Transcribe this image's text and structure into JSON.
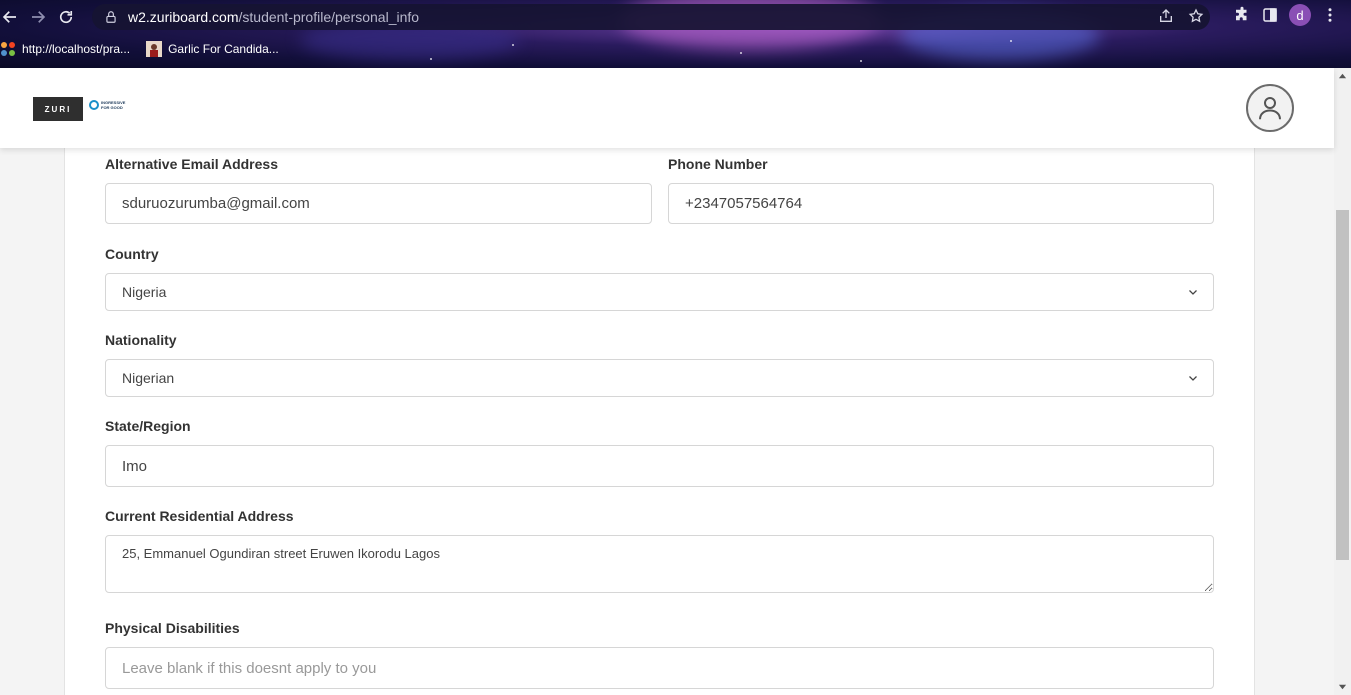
{
  "browser": {
    "url_host": "w2.zuriboard.com",
    "url_path": "/student-profile/personal_info",
    "profile_initial": "d",
    "bookmarks": [
      {
        "label": "http://localhost/pra..."
      },
      {
        "label": "Garlic For Candida..."
      }
    ]
  },
  "header": {
    "logo_text": "ZURI",
    "partner_logo_line1": "INGRESSIVE",
    "partner_logo_line2": "FOR GOOD"
  },
  "form": {
    "alt_email": {
      "label": "Alternative Email Address",
      "value": "sduruozurumba@gmail.com"
    },
    "phone": {
      "label": "Phone Number",
      "value": "+2347057564764"
    },
    "country": {
      "label": "Country",
      "value": "Nigeria"
    },
    "nationality": {
      "label": "Nationality",
      "value": "Nigerian"
    },
    "state": {
      "label": "State/Region",
      "value": "Imo"
    },
    "address": {
      "label": "Current Residential Address",
      "value": "25, Emmanuel Ogundiran street Eruwen Ikorodu Lagos"
    },
    "disabilities": {
      "label": "Physical Disabilities",
      "value": "",
      "placeholder": "Leave blank if this doesnt apply to you"
    }
  }
}
